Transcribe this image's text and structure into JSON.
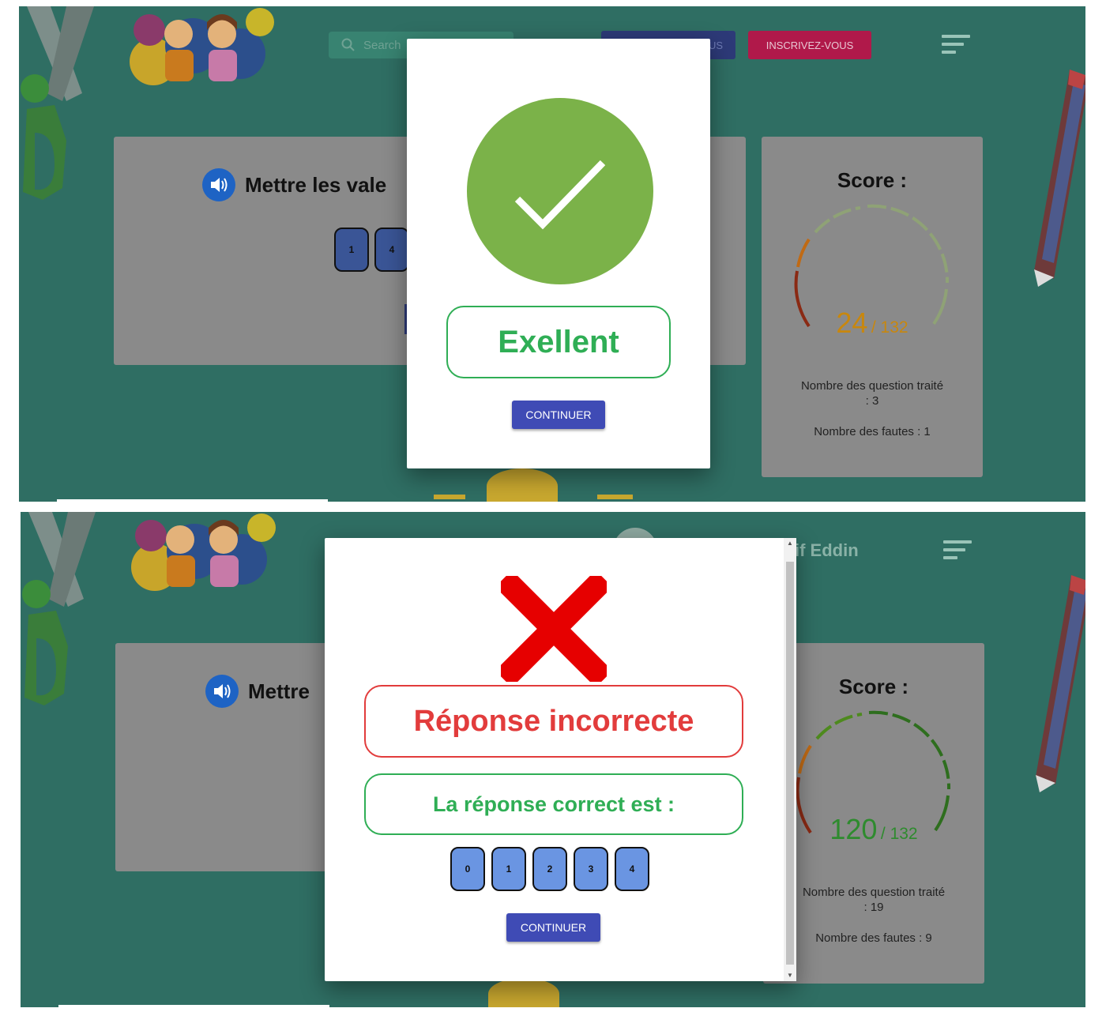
{
  "top": {
    "search_placeholder": "Search",
    "login_label": "CONNECTEZ-VOUS",
    "login_visible": "US",
    "signup_label": "INSCRIVEZ-VOUS",
    "question_title": "Mettre les vale",
    "tiles": [
      "1",
      "4"
    ],
    "score": {
      "title": "Score :",
      "value": "24",
      "total": "/ 132",
      "value_color": "#c8870e",
      "questions_label": "Nombre des question traité",
      "questions_value": ": 3",
      "errors_label": "Nombre des fautes : 1"
    },
    "dialog": {
      "message": "Exellent",
      "continue_label": "CONTINUER",
      "icon": "check-icon"
    }
  },
  "bottom": {
    "user_name": "if Eddin",
    "question_title": "Mettre",
    "score": {
      "title": "Score :",
      "value": "120",
      "total": "/ 132",
      "value_color": "#2e8b2e",
      "questions_label": "Nombre des question traité",
      "questions_value": ": 19",
      "errors_label": "Nombre des fautes : 9"
    },
    "dialog": {
      "message": "Réponse incorrecte",
      "correct_label": "La réponse correct est :",
      "answer_tiles": [
        "0",
        "1",
        "2",
        "3",
        "4"
      ],
      "continue_label": "CONTINUER",
      "icon": "cross-icon"
    }
  },
  "colors": {
    "background": "#2f6e63",
    "success": "#2fae55",
    "error": "#e23c3c",
    "primary_button": "#3f4bb5",
    "signup_button": "#b0194a"
  }
}
